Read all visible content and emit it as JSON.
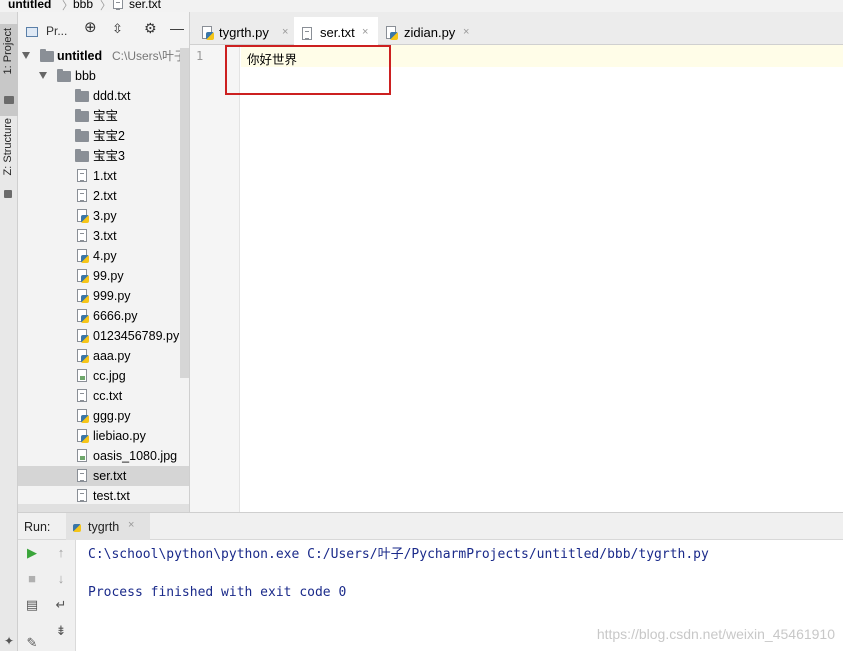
{
  "breadcrumb": {
    "project": "untitled",
    "folder": "bbb",
    "file": "ser.txt"
  },
  "side_tabs": {
    "project": "1: Project",
    "structure": "Z: Structure"
  },
  "project_panel": {
    "title": "Pr...",
    "root_name": "untitled",
    "root_path": "C:\\Users\\叶子",
    "folder": "bbb",
    "items": [
      {
        "name": "ddd.txt",
        "type": "folder"
      },
      {
        "name": "宝宝",
        "type": "folder"
      },
      {
        "name": "宝宝2",
        "type": "folder"
      },
      {
        "name": "宝宝3",
        "type": "folder"
      },
      {
        "name": "1.txt",
        "type": "txt"
      },
      {
        "name": "2.txt",
        "type": "txt"
      },
      {
        "name": "3.py",
        "type": "py"
      },
      {
        "name": "3.txt",
        "type": "txt"
      },
      {
        "name": "4.py",
        "type": "py"
      },
      {
        "name": "99.py",
        "type": "py"
      },
      {
        "name": "999.py",
        "type": "py"
      },
      {
        "name": "6666.py",
        "type": "py"
      },
      {
        "name": "0123456789.py",
        "type": "py"
      },
      {
        "name": "aaa.py",
        "type": "py"
      },
      {
        "name": "cc.jpg",
        "type": "jpg"
      },
      {
        "name": "cc.txt",
        "type": "txt"
      },
      {
        "name": "ggg.py",
        "type": "py"
      },
      {
        "name": "liebiao.py",
        "type": "py"
      },
      {
        "name": "oasis_1080.jpg",
        "type": "jpg"
      },
      {
        "name": "ser.txt",
        "type": "txt",
        "selected": true
      },
      {
        "name": "test.txt",
        "type": "txt"
      }
    ]
  },
  "editor_tabs": [
    {
      "name": "tygrth.py",
      "type": "py",
      "close": "×"
    },
    {
      "name": "ser.txt",
      "type": "txt",
      "close": "×",
      "active": true
    },
    {
      "name": "zidian.py",
      "type": "py",
      "close": "×"
    }
  ],
  "editor": {
    "line_number": "1",
    "content": "你好世界"
  },
  "run_panel": {
    "label": "Run:",
    "tab_name": "tygrth",
    "tab_close": "×",
    "output": [
      "C:\\school\\python\\python.exe C:/Users/叶子/PycharmProjects/untitled/bbb/tygrth.py",
      "",
      "Process finished with exit code 0"
    ]
  },
  "watermark": "https://blog.csdn.net/weixin_45461910",
  "colors": {
    "highlight_box": "#cc2020",
    "console_text": "#1a2a8a",
    "selection": "#d5d5d5"
  }
}
